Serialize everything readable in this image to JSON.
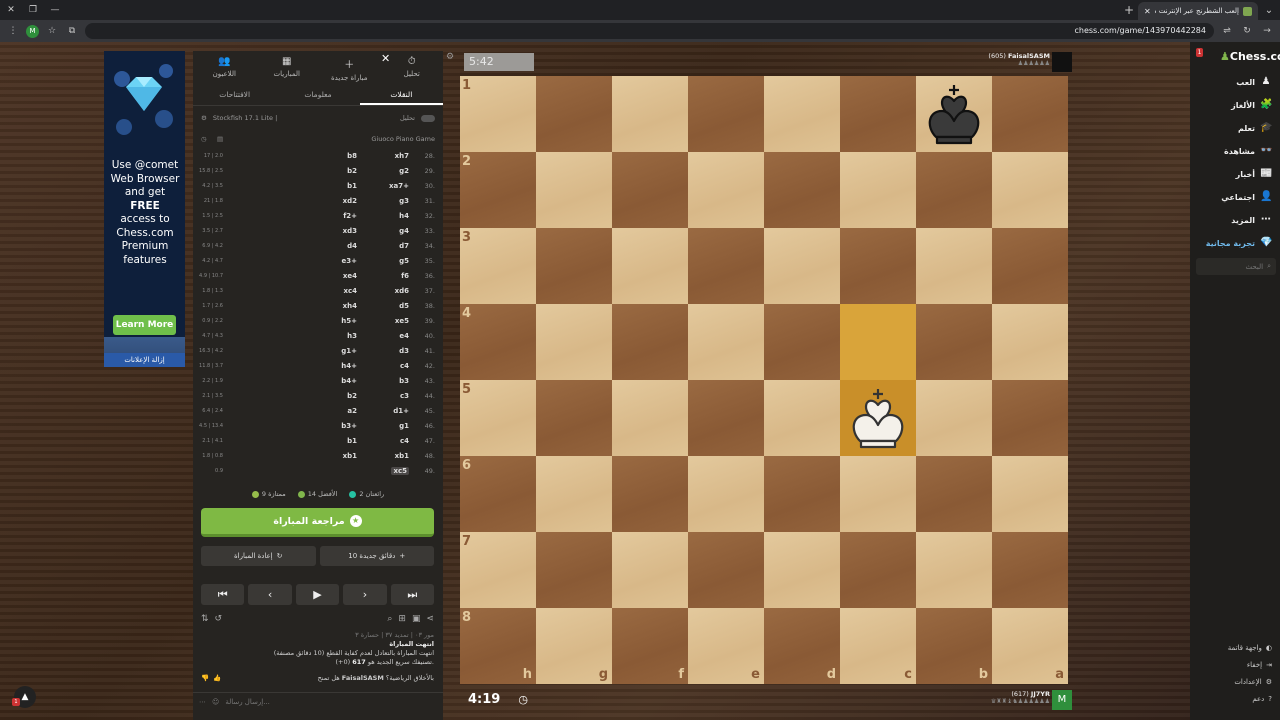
{
  "browser": {
    "tab_title": "إلعب الشطرنج عبر الإنترنت مجاناً!",
    "url": "chess.com/game/143970442284",
    "profile_initial": "M"
  },
  "ad": {
    "text_prefix": "Use ",
    "brand": "@comet",
    "line2": "Web Browser",
    "line3_a": "and get ",
    "line3_b": "FREE",
    "line4": "access to",
    "line5": "Chess.com",
    "line6": "Premium",
    "line7": "features",
    "button": "Learn More",
    "remove": "إزالة الإعلانات"
  },
  "panel": {
    "nav": [
      {
        "label": "تحليل",
        "icon": "analysis-icon",
        "glyph": "⏱"
      },
      {
        "label": "مباراة جديدة",
        "icon": "new-game-icon",
        "glyph": "＋"
      },
      {
        "label": "المباريات",
        "icon": "games-icon",
        "glyph": "▦"
      },
      {
        "label": "اللاعبون",
        "icon": "players-icon",
        "glyph": "👥"
      }
    ],
    "close_glyph": "✕",
    "subtabs": [
      {
        "label": "النقلات",
        "active": true
      },
      {
        "label": "معلومات",
        "active": false
      },
      {
        "label": "الافتتاحات",
        "active": false
      }
    ],
    "engine_label": "تحليل",
    "engine_name": "Stockfish 17.1 Lite |",
    "opening_name": "Giuoco Piano Game",
    "moves": [
      {
        "n": "28.",
        "w": "xh7",
        "b": "b8",
        "e": "17 | 2.0"
      },
      {
        "n": "29.",
        "w": "g2",
        "b": "b2",
        "e": "15.8 | 2.5"
      },
      {
        "n": "30.",
        "w": "xa7+",
        "b": "b1",
        "e": "4.2 | 3.5"
      },
      {
        "n": "31.",
        "w": "g3",
        "b": "xd2",
        "e": "21 | 1.8"
      },
      {
        "n": "32.",
        "w": "h4",
        "b": "f2+",
        "e": "1.5 | 2.5"
      },
      {
        "n": "33.",
        "w": "g4",
        "b": "xd3",
        "e": "3.5 | 2.7"
      },
      {
        "n": "34.",
        "w": "d7",
        "b": "d4",
        "e": "6.9 | 4.2"
      },
      {
        "n": "35.",
        "w": "g5",
        "b": "e3+",
        "e": "4.2 | 4.7"
      },
      {
        "n": "36.",
        "w": "f6",
        "b": "xe4",
        "e": "4.9 | 10.7"
      },
      {
        "n": "37.",
        "w": "xd6",
        "b": "xc4",
        "e": "1.8 | 1.3"
      },
      {
        "n": "38.",
        "w": "d5",
        "b": "xh4",
        "e": "1.7 | 2.6"
      },
      {
        "n": "39.",
        "w": "xe5",
        "b": "h5+",
        "e": "0.9 | 2.2"
      },
      {
        "n": "40.",
        "w": "e4",
        "b": "h3",
        "e": "4.7 | 4.3"
      },
      {
        "n": "41.",
        "w": "d3",
        "b": "g1+",
        "e": "16.3 | 4.2"
      },
      {
        "n": "42.",
        "w": "c4",
        "b": "h4+",
        "e": "11.8 | 3.7"
      },
      {
        "n": "43.",
        "w": "b3",
        "b": "b4+",
        "e": "2.2 | 1.9"
      },
      {
        "n": "44.",
        "w": "c3",
        "b": "b2",
        "e": "2.1 | 3.5"
      },
      {
        "n": "45.",
        "w": "d1+",
        "b": "a2",
        "e": "6.4 | 2.4"
      },
      {
        "n": "46.",
        "w": "g1",
        "b": "b3+",
        "e": "4.5 | 13.4"
      },
      {
        "n": "47.",
        "w": "c4",
        "b": "b1",
        "e": "2.1 | 4.1"
      },
      {
        "n": "48.",
        "w": "xb1",
        "b": "xb1",
        "e": "1.8 | 0.8"
      },
      {
        "n": "49.",
        "w": "xc5",
        "b": "",
        "e": "0.9"
      }
    ],
    "summary": [
      {
        "label": "2 رائعتان",
        "color": "#26c2a3"
      },
      {
        "label": "14 الأفضل",
        "color": "#81b64c"
      },
      {
        "label": "9 ممتازة",
        "color": "#96bc4b"
      }
    ],
    "review_button": "مراجعة المباراة",
    "new_game_button": "10 دقائق جديدة",
    "rematch_button": "إعادة المباراة",
    "nav_first": "⏮",
    "nav_prev": "‹",
    "nav_play": "▶",
    "nav_next": "›",
    "nav_last": "⏭",
    "result_cut": "مور ٠٣ | تمديد ٣٧ | حسارة ٣",
    "result_title": "انتهت المباراة",
    "result_line1": "انتهت المباراة بالتعادل لعدم كفاية القطع (10 دقائق مصنفة)",
    "result_line2_a": "تصنيفك سريع الجديد هو ",
    "result_line2_b": "617",
    "result_line2_c": " (0+).",
    "chat_question_a": "هل تمنح ",
    "chat_question_name": "FaisalSASM",
    "chat_question_b": " بالأخلاق الرياضية؟",
    "chat_placeholder": "إرسال رسالة..."
  },
  "board": {
    "opponent_clock": "5:42",
    "opponent_name": "FaisalSASM",
    "opponent_rating": "(605)",
    "my_clock": "4:19",
    "my_name": "JJ7YR",
    "my_rating": "(617)",
    "my_initial": "M",
    "ranks": [
      "1",
      "2",
      "3",
      "4",
      "5",
      "6",
      "7",
      "8"
    ],
    "files": [
      "h",
      "g",
      "f",
      "e",
      "d",
      "c",
      "b",
      "a"
    ],
    "black_king_square": "b1",
    "white_king_square": "c5",
    "highlighted_squares": [
      "c4",
      "c5"
    ]
  },
  "sidebar": {
    "logo": "Chess.com",
    "notification_count": "1",
    "items": [
      {
        "label": "العب",
        "icon": "play-icon",
        "glyph": "♟"
      },
      {
        "label": "الألغاز",
        "icon": "puzzles-icon",
        "glyph": "🧩"
      },
      {
        "label": "تعلم",
        "icon": "learn-icon",
        "glyph": "🎓"
      },
      {
        "label": "مشاهدة",
        "icon": "watch-icon",
        "glyph": "👓"
      },
      {
        "label": "أخبار",
        "icon": "news-icon",
        "glyph": "📰"
      },
      {
        "label": "اجتماعي",
        "icon": "social-icon",
        "glyph": "👤"
      },
      {
        "label": "المزيد",
        "icon": "more-icon",
        "glyph": "⋯"
      },
      {
        "label": "تجربة مجانية",
        "icon": "free-trial-icon",
        "glyph": "💎"
      }
    ],
    "search_placeholder": "البحث",
    "bottom": [
      {
        "label": "واجهة قاتمة",
        "icon": "theme-icon",
        "glyph": "◐"
      },
      {
        "label": "إخفاء",
        "icon": "collapse-icon",
        "glyph": "⇥"
      },
      {
        "label": "الإعدادات",
        "icon": "settings-icon",
        "glyph": "⚙"
      },
      {
        "label": "دعم",
        "icon": "help-icon",
        "glyph": "?"
      }
    ]
  }
}
